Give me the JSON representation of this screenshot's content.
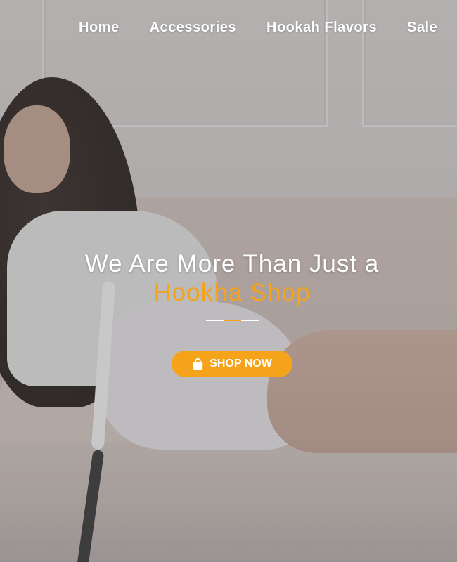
{
  "nav": {
    "items": [
      {
        "label": "Home"
      },
      {
        "label": "Accessories"
      },
      {
        "label": "Hookah Flavors"
      },
      {
        "label": "Sale"
      }
    ]
  },
  "hero": {
    "headline": "We Are More Than Just a",
    "headline_accent": "Hookha Shop",
    "cta_label": "SHOP NOW",
    "cta_icon": "shopping-bag-icon"
  },
  "colors": {
    "accent": "#f5a31a",
    "text": "#ffffff"
  }
}
